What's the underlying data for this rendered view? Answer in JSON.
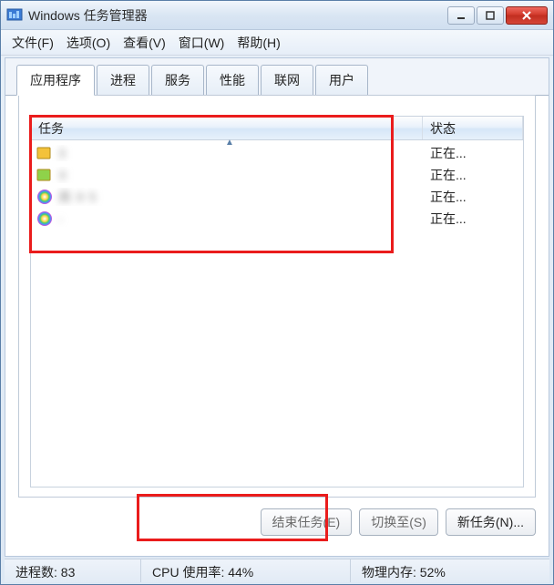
{
  "window": {
    "title": "Windows 任务管理器"
  },
  "menu": {
    "file": "文件(F)",
    "options": "选项(O)",
    "view": "查看(V)",
    "windows": "窗口(W)",
    "help": "帮助(H)"
  },
  "tabs": {
    "applications": "应用程序",
    "processes": "进程",
    "services": "服务",
    "performance": "性能",
    "network": "联网",
    "users": "用户"
  },
  "columns": {
    "task": "任务",
    "status": "状态"
  },
  "rows": [
    {
      "icon_color": "#f3c23a",
      "name": "3   ",
      "status": "正在..."
    },
    {
      "icon_color": "#8fd24a",
      "name": "X  ",
      "status": "正在..."
    },
    {
      "icon_color": "rainbow",
      "name": "高         9 5",
      "status": "正在..."
    },
    {
      "icon_color": "rainbow",
      "name": "-  ",
      "status": "正在..."
    }
  ],
  "buttons": {
    "end_task": "结束任务(E)",
    "switch_to": "切换至(S)",
    "new_task": "新任务(N)..."
  },
  "statusbar": {
    "processes_label": "进程数:",
    "processes_value": "83",
    "cpu_label": "CPU 使用率:",
    "cpu_value": "44%",
    "mem_label": "物理内存:",
    "mem_value": "52%"
  }
}
